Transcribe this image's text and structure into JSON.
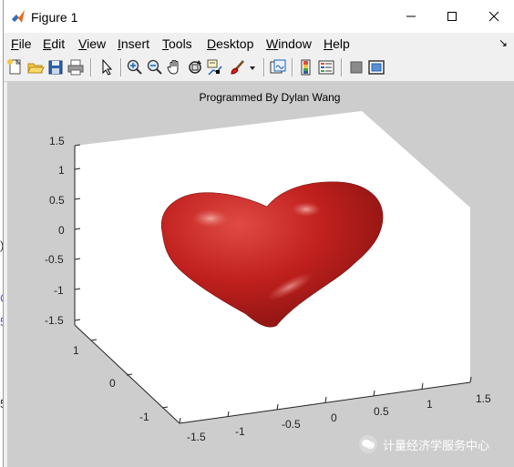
{
  "window": {
    "title": "Figure 1",
    "controls": {
      "minimize": "—",
      "maximize": "☐",
      "close": "✕"
    }
  },
  "menubar": {
    "items": [
      {
        "pre": "",
        "ul": "F",
        "post": "ile"
      },
      {
        "pre": "",
        "ul": "E",
        "post": "dit"
      },
      {
        "pre": "",
        "ul": "V",
        "post": "iew"
      },
      {
        "pre": "",
        "ul": "I",
        "post": "nsert"
      },
      {
        "pre": "",
        "ul": "T",
        "post": "ools"
      },
      {
        "pre": "",
        "ul": "D",
        "post": "esktop"
      },
      {
        "pre": "",
        "ul": "W",
        "post": "indow"
      },
      {
        "pre": "",
        "ul": "H",
        "post": "elp"
      }
    ],
    "overflow_arrow": "↘"
  },
  "toolbar": {
    "icons": [
      "new-figure-icon",
      "open-file-icon",
      "save-icon",
      "print-icon",
      "pointer-icon",
      "zoom-in-icon",
      "zoom-out-icon",
      "pan-icon",
      "rotate-3d-icon",
      "data-cursor-icon",
      "brush-icon",
      "brush-dropdown-icon",
      "link-plot-icon",
      "colorbar-icon",
      "legend-icon",
      "hide-plot-tools-icon",
      "show-plot-tools-icon"
    ]
  },
  "plot": {
    "title": "Programmed By Dylan Wang",
    "z_ticks": [
      "1.5",
      "1",
      "0.5",
      "0",
      "-0.5",
      "-1",
      "-1.5"
    ],
    "y_ticks": [
      "1",
      "0",
      "-1"
    ],
    "x_ticks": [
      "-1.5",
      "-1",
      "-0.5",
      "0",
      "0.5",
      "1",
      "1.5"
    ],
    "surface_color": "#c0201e",
    "background_color": "#cdcdcd"
  },
  "chart_data": {
    "type": "surface",
    "title": "Programmed By Dylan Wang",
    "xlim": [
      -1.5,
      1.5
    ],
    "ylim": [
      -1.5,
      1.5
    ],
    "zlim": [
      -1.5,
      1.5
    ],
    "x_ticks": [
      -1.5,
      -1,
      -0.5,
      0,
      0.5,
      1,
      1.5
    ],
    "y_ticks": [
      -1,
      0,
      1
    ],
    "z_ticks": [
      -1.5,
      -1,
      -0.5,
      0,
      0.5,
      1,
      1.5
    ],
    "grid": false,
    "surface": "heart"
  },
  "watermark": {
    "text": "计量经济学服务中心"
  },
  "background_left": {
    "chars": [
      ")",
      "C",
      "5",
      "5"
    ]
  }
}
